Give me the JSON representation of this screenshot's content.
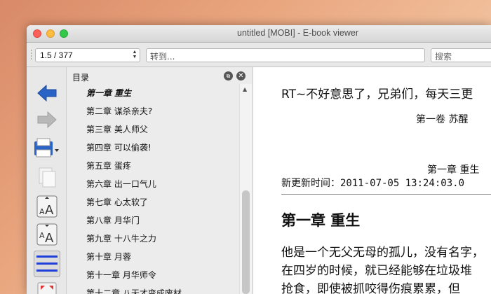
{
  "window": {
    "title": "untitled [MOBI] - E-book viewer"
  },
  "toolbar": {
    "page_value": "1.5 / 377",
    "goto_placeholder": "转到...",
    "search_placeholder": "搜索"
  },
  "left_tools": {
    "icons": [
      "back-arrow-icon",
      "forward-arrow-icon",
      "print-icon",
      "copy-icon",
      "font-larger-icon",
      "font-smaller-icon",
      "toc-lines-icon",
      "fullscreen-icon"
    ]
  },
  "toc": {
    "title": "目录",
    "items": [
      "第一章 重生",
      "第二章 谋杀亲夫?",
      "第三章 美人师父",
      "第四章 可以偷袭!",
      "第五章 蛋疼",
      "第六章 出一口气儿",
      "第七章 心太软了",
      "第八章 月华门",
      "第九章 十八牛之力",
      "第十章 月蓉",
      "第十一章 月华师令",
      "第十二章 八天才变成废材"
    ]
  },
  "content": {
    "top_line": "RT~不好意思了，兄弟们，每天三更",
    "volume": "第一卷  苏醒",
    "chapter_right": "第一章  重生",
    "update_line": "新更新时间：2011-07-05 13:24:03.0",
    "heading": "第一章 重生",
    "para1": "他是一个无父无母的孤儿，没有名字，",
    "para2": "在四岁的时候，就已经能够在垃圾堆",
    "para3": "抢食，即使被抓咬得伤痕累累，但"
  },
  "colors": {
    "accent_blue": "#2a63c6",
    "gray_icon": "#b8b8b8"
  }
}
